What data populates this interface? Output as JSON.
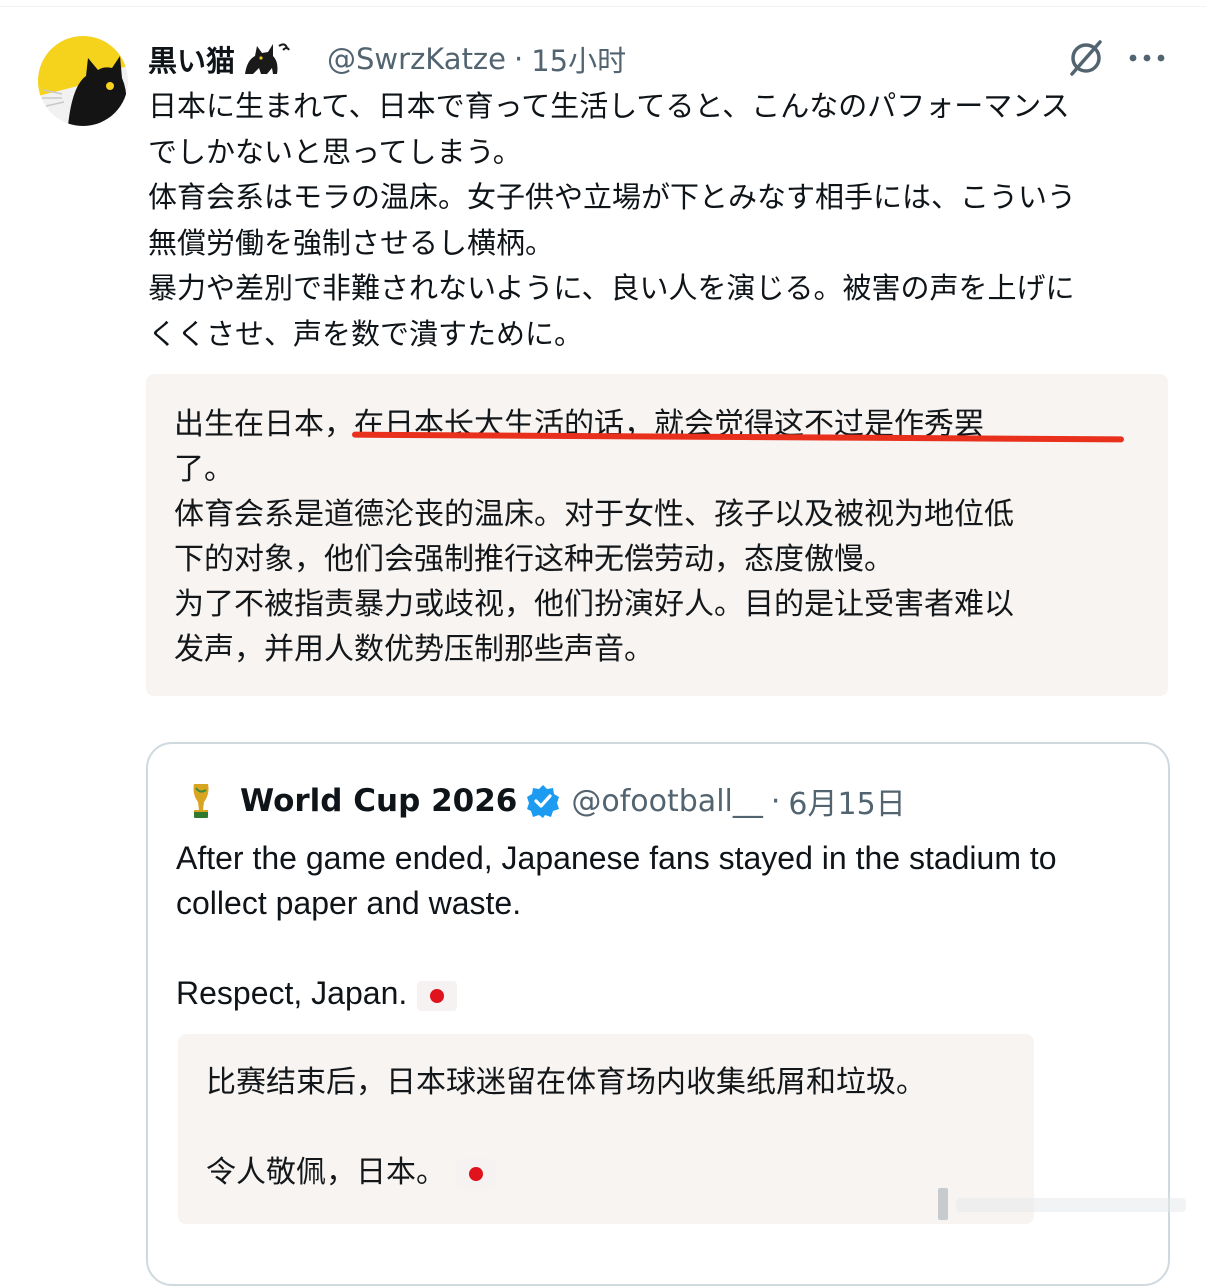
{
  "tweet": {
    "display_name": "黒い猫",
    "name_decoration": "cat-emoji",
    "handle": "@SwrzKatze",
    "separator": "·",
    "time": "15小时",
    "text_lines": [
      "日本に生まれて、日本で育って生活してると、こんなのパフォーマンス",
      "でしかないと思ってしまう。",
      "体育会系はモラの温床。女子供や立場が下とみなす相手には、こういう",
      "無償労働を強制させるし横柄。",
      "暴力や差別で非難されないように、良い人を演じる。被害の声を上げに",
      "くくさせ、声を数で潰すために。"
    ],
    "translation_lines": [
      "出生在日本，在日本长大生活的话，就会觉得这不过是作秀罢",
      "了。",
      "体育会系是道德沦丧的温床。对于女性、孩子以及被视为地位低",
      "下的对象，他们会强制推行这种无偿劳动，态度傲慢。",
      "为了不被指责暴力或歧视，他们扮演好人。目的是让受害者难以",
      "发声，并用人数优势压制那些声音。"
    ],
    "highlight_color": "#e8301c"
  },
  "quoted": {
    "display_name": "World Cup 2026",
    "handle": "@ofootball__",
    "separator": "·",
    "date": "6月15日",
    "text_line1": "After the game ended, Japanese fans stayed in the stadium to",
    "text_line2": "collect paper and waste.",
    "text_line3": "Respect, Japan.",
    "translation_line1": "比赛结束后，日本球迷留在体育场内收集纸屑和垃圾。",
    "translation_line2": "令人敬佩，日本。",
    "verified_color": "#1d9bf0",
    "icons": [
      "trophy-icon",
      "verified-icon",
      "japan-flag-icon"
    ]
  },
  "colors": {
    "text": "#0f1419",
    "secondary": "#536471",
    "translation_bg": "#f7f4f2",
    "border": "#cfd9de"
  }
}
